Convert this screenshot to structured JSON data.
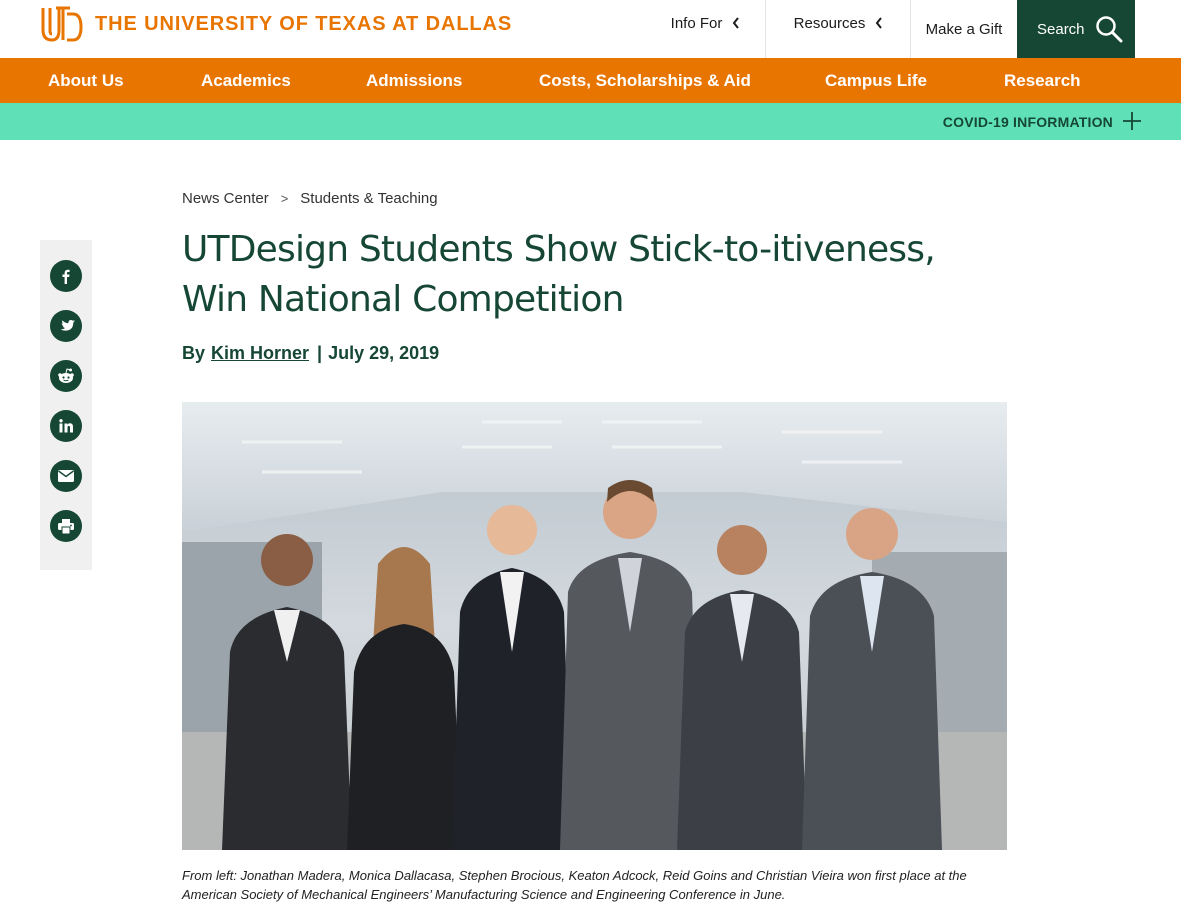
{
  "brand": {
    "monogram": "UTD",
    "name": "THE UNIVERSITY OF TEXAS AT DALLAS",
    "accent": "#e87500",
    "green": "#154734",
    "mint": "#5fe0b7"
  },
  "utility": {
    "info_for": "Info For",
    "resources": "Resources",
    "make_gift": "Make a Gift",
    "search": "Search"
  },
  "nav": {
    "items": [
      {
        "label": "About Us"
      },
      {
        "label": "Academics"
      },
      {
        "label": "Admissions"
      },
      {
        "label": "Costs, Scholarships & Aid"
      },
      {
        "label": "Campus Life"
      },
      {
        "label": "Research"
      }
    ]
  },
  "covid": {
    "label": "COVID-19 INFORMATION"
  },
  "share": {
    "icons": [
      "facebook-icon",
      "twitter-icon",
      "reddit-icon",
      "linkedin-icon",
      "email-icon",
      "print-icon"
    ]
  },
  "breadcrumb": {
    "items": [
      "News Center",
      "Students & Teaching"
    ],
    "separator": ">"
  },
  "article": {
    "title": "UTDesign Students Show Stick-to-itiveness, Win National Competition",
    "by": "By",
    "author": "Kim Horner",
    "date": "July 29, 2019",
    "caption": "From left: Jonathan Madera, Monica Dallacasa, Stephen Brocious, Keaton Adcock, Reid Goins and Christian Vieira won first place at the American Society of Mechanical Engineers’ Manufacturing Science and Engineering Conference in June."
  }
}
